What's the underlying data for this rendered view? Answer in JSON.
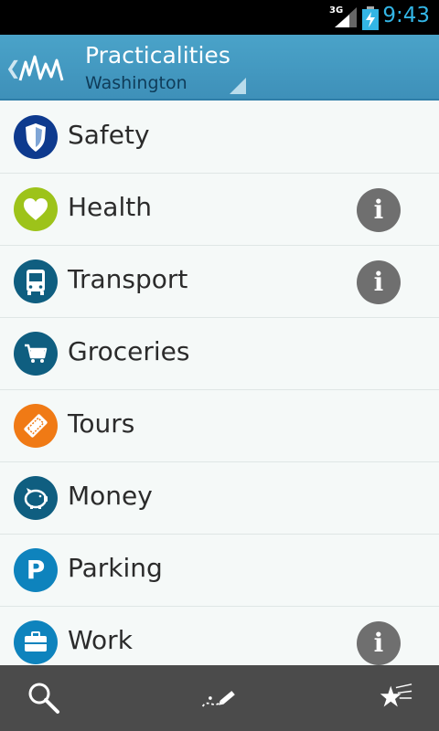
{
  "status": {
    "network": "3G",
    "time": "9:43"
  },
  "header": {
    "title": "Practicalities",
    "subtitle": "Washington"
  },
  "items": [
    {
      "label": "Safety",
      "icon": "shield-icon",
      "color": "#0e3a8e",
      "info": false
    },
    {
      "label": "Health",
      "icon": "heart-icon",
      "color": "#9dc31a",
      "info": true
    },
    {
      "label": "Transport",
      "icon": "bus-icon",
      "color": "#0f5e80",
      "info": true
    },
    {
      "label": "Groceries",
      "icon": "cart-icon",
      "color": "#0f5e80",
      "info": false
    },
    {
      "label": "Tours",
      "icon": "ticket-icon",
      "color": "#f07a15",
      "info": false
    },
    {
      "label": "Money",
      "icon": "piggy-bank-icon",
      "color": "#0f5e80",
      "info": false
    },
    {
      "label": "Parking",
      "icon": "parking-icon",
      "color": "#0e83bd",
      "info": false
    },
    {
      "label": "Work",
      "icon": "briefcase-icon",
      "color": "#0e83bd",
      "info": true
    }
  ],
  "info_glyph": "i",
  "parking_glyph": "P"
}
